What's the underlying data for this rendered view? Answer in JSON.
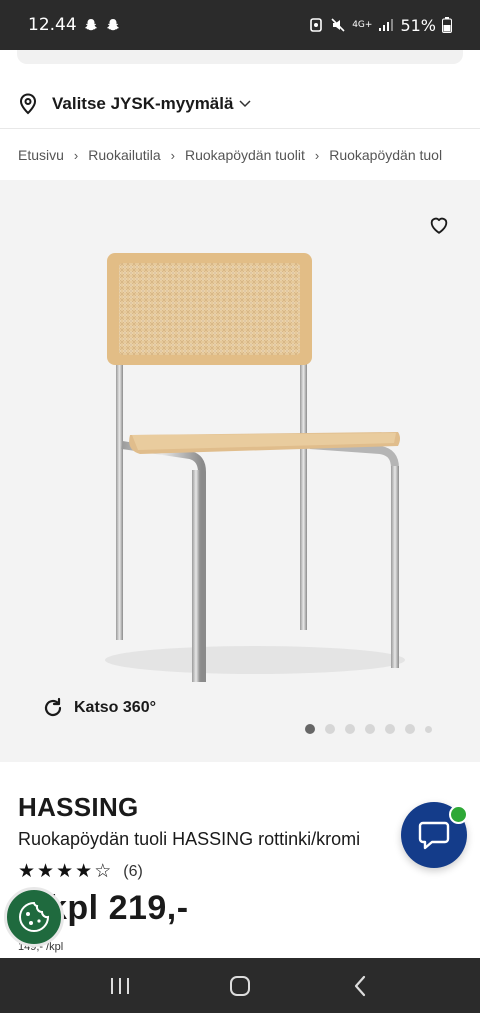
{
  "status_bar": {
    "time": "12.44",
    "battery": "51%",
    "network": "4G+"
  },
  "store": {
    "label": "Valitse JYSK-myymälä"
  },
  "breadcrumb": {
    "items": [
      "Etusivu",
      "Ruokailutila",
      "Ruokapöydän tuolit",
      "Ruokapöydän tuol"
    ]
  },
  "gallery": {
    "view360_label": "Katso 360°",
    "image_count": 7,
    "active_index": 0
  },
  "product": {
    "brand": "HASSING",
    "name": "Ruokapöydän tuoli HASSING rottinki/kromi",
    "rating": 4,
    "rating_max": 5,
    "review_count": "(6)",
    "price": "kpl 219,-",
    "unit_price": "149,- /kpl"
  },
  "colors": {
    "chat_fab": "#143c8a",
    "chat_badge": "#2ea836",
    "cookie_fab": "#1f6a3e",
    "system_bars": "#2b2b2b"
  }
}
